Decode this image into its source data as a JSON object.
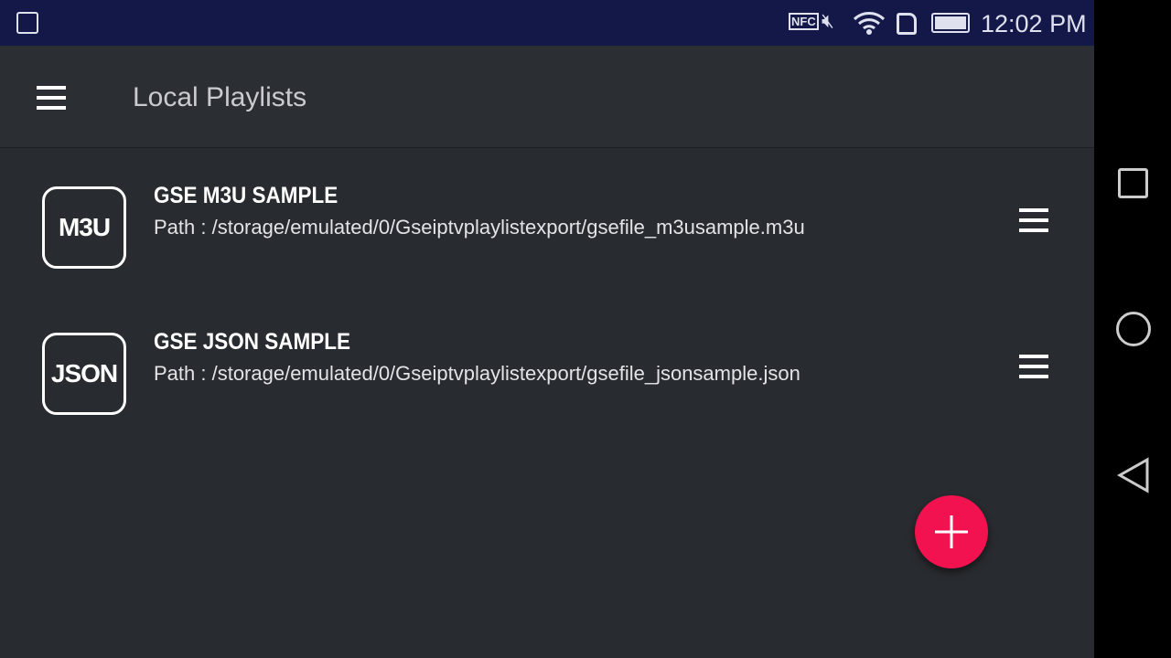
{
  "status_bar": {
    "time": "12:02 PM",
    "nfc": "NFC",
    "icons": [
      "image-icon",
      "nfc-icon",
      "mute-icon",
      "wifi-icon",
      "sim-alert-icon",
      "battery-icon"
    ]
  },
  "app_bar": {
    "title": "Local Playlists"
  },
  "playlists": [
    {
      "badge": "M3U",
      "name": "GSE M3U SAMPLE",
      "path": "Path : /storage/emulated/0/Gseiptvplaylistexport/gsefile_m3usample.m3u"
    },
    {
      "badge": "JSON",
      "name": "GSE JSON SAMPLE",
      "path": "Path : /storage/emulated/0/Gseiptvplaylistexport/gsefile_jsonsample.json"
    }
  ],
  "colors": {
    "fab": "#f2124f",
    "status_bar": "#131849",
    "background": "#282b2f"
  }
}
